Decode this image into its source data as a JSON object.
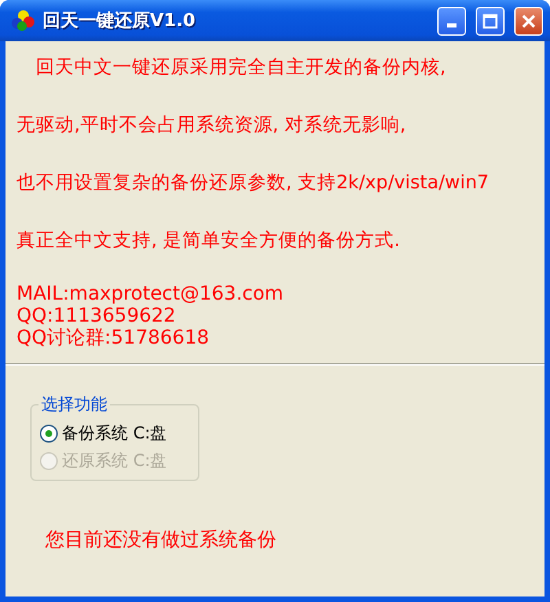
{
  "window": {
    "title": "回天一键还原V1.0"
  },
  "intro": [
    "回天中文一键还原采用完全自主开发的备份内核,",
    "无驱动,平时不会占用系统资源, 对系统无影响,",
    "也不用设置复杂的备份还原参数, 支持2k/xp/vista/win7",
    "真正全中文支持, 是简单安全方便的备份方式."
  ],
  "contact": [
    "MAIL:maxprotect@163.com",
    "QQ:1113659622",
    "QQ讨论群:51786618"
  ],
  "group": {
    "title": "选择功能",
    "options": [
      {
        "label": "备份系统 C:盘",
        "selected": true,
        "disabled": false
      },
      {
        "label": "还原系统 C:盘",
        "selected": false,
        "disabled": true
      }
    ]
  },
  "status": "您目前还没有做过系统备份"
}
